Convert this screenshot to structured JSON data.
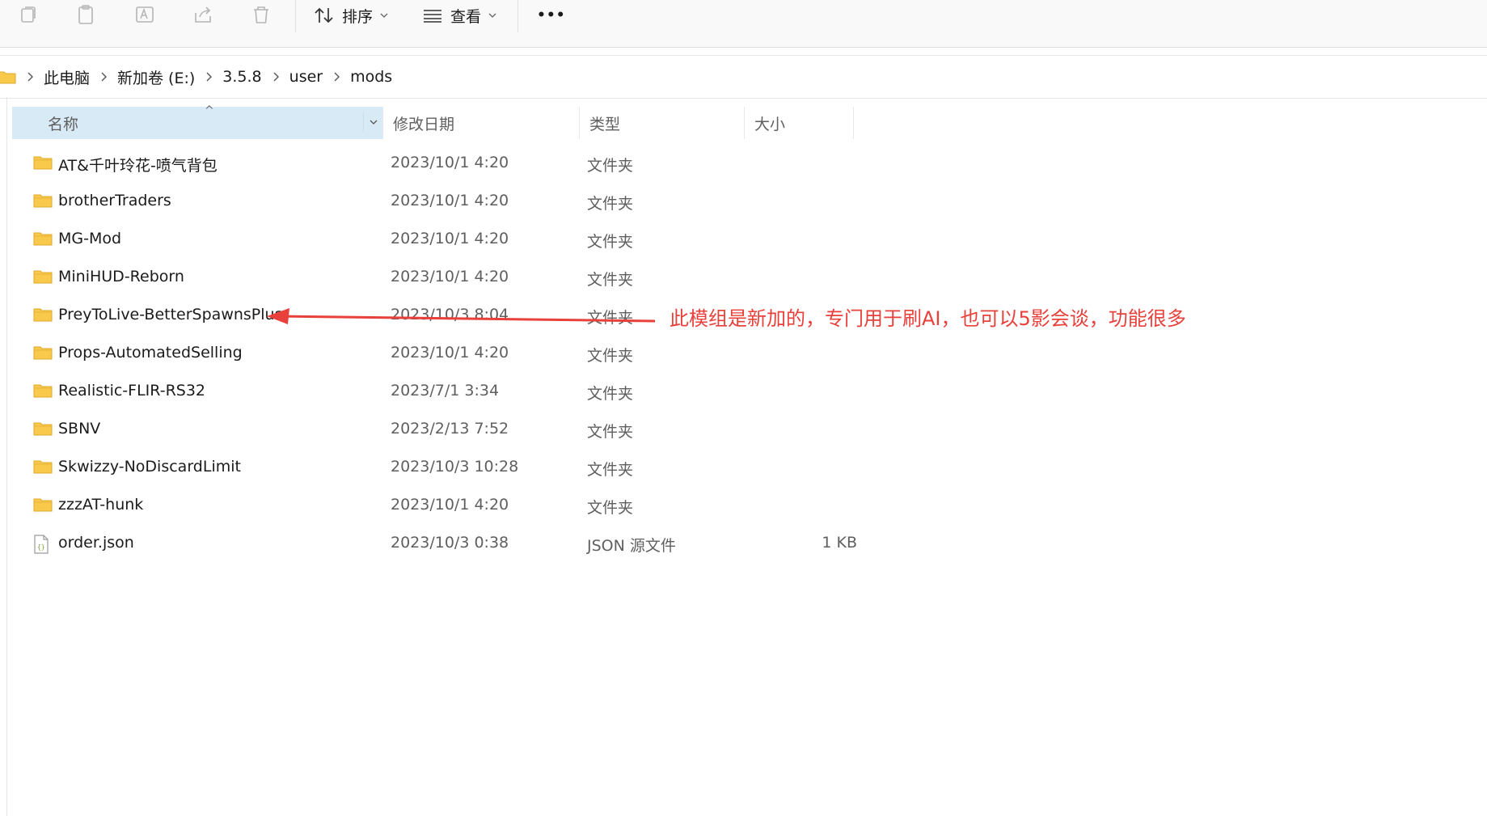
{
  "toolbar": {
    "icons": [
      "copy-icon",
      "paste-icon",
      "rename-icon",
      "share-icon",
      "delete-icon"
    ],
    "sort_label": "排序",
    "view_label": "查看",
    "more_label": "•••"
  },
  "breadcrumb": [
    "此电脑",
    "新加卷 (E:)",
    "3.5.8",
    "user",
    "mods"
  ],
  "columns": {
    "name": "名称",
    "date": "修改日期",
    "type": "类型",
    "size": "大小"
  },
  "files": [
    {
      "name": "AT&千叶玲花-喷气背包",
      "date": "2023/10/1 4:20",
      "type": "文件夹",
      "size": "",
      "icon": "folder-icon"
    },
    {
      "name": "brotherTraders",
      "date": "2023/10/1 4:20",
      "type": "文件夹",
      "size": "",
      "icon": "folder-icon"
    },
    {
      "name": "MG-Mod",
      "date": "2023/10/1 4:20",
      "type": "文件夹",
      "size": "",
      "icon": "folder-icon"
    },
    {
      "name": "MiniHUD-Reborn",
      "date": "2023/10/1 4:20",
      "type": "文件夹",
      "size": "",
      "icon": "folder-icon"
    },
    {
      "name": "PreyToLive-BetterSpawnsPlus",
      "date": "2023/10/3 8:04",
      "type": "文件夹",
      "size": "",
      "icon": "folder-icon"
    },
    {
      "name": "Props-AutomatedSelling",
      "date": "2023/10/1 4:20",
      "type": "文件夹",
      "size": "",
      "icon": "folder-icon"
    },
    {
      "name": "Realistic-FLIR-RS32",
      "date": "2023/7/1 3:34",
      "type": "文件夹",
      "size": "",
      "icon": "folder-icon"
    },
    {
      "name": "SBNV",
      "date": "2023/2/13 7:52",
      "type": "文件夹",
      "size": "",
      "icon": "folder-icon"
    },
    {
      "name": "Skwizzy-NoDiscardLimit",
      "date": "2023/10/3 10:28",
      "type": "文件夹",
      "size": "",
      "icon": "folder-icon"
    },
    {
      "name": "zzzAT-hunk",
      "date": "2023/10/1 4:20",
      "type": "文件夹",
      "size": "",
      "icon": "folder-icon"
    },
    {
      "name": "order.json",
      "date": "2023/10/3 0:38",
      "type": "JSON 源文件",
      "size": "1 KB",
      "icon": "json-file-icon"
    }
  ],
  "annotation": {
    "text": "此模组是新加的，专门用于刷AI，也可以5影会谈，功能很多",
    "color": "#e8403a"
  },
  "colors": {
    "header_selected": "#d9eaf7",
    "folder": "#f8c94a",
    "accent": "#0067c0"
  }
}
